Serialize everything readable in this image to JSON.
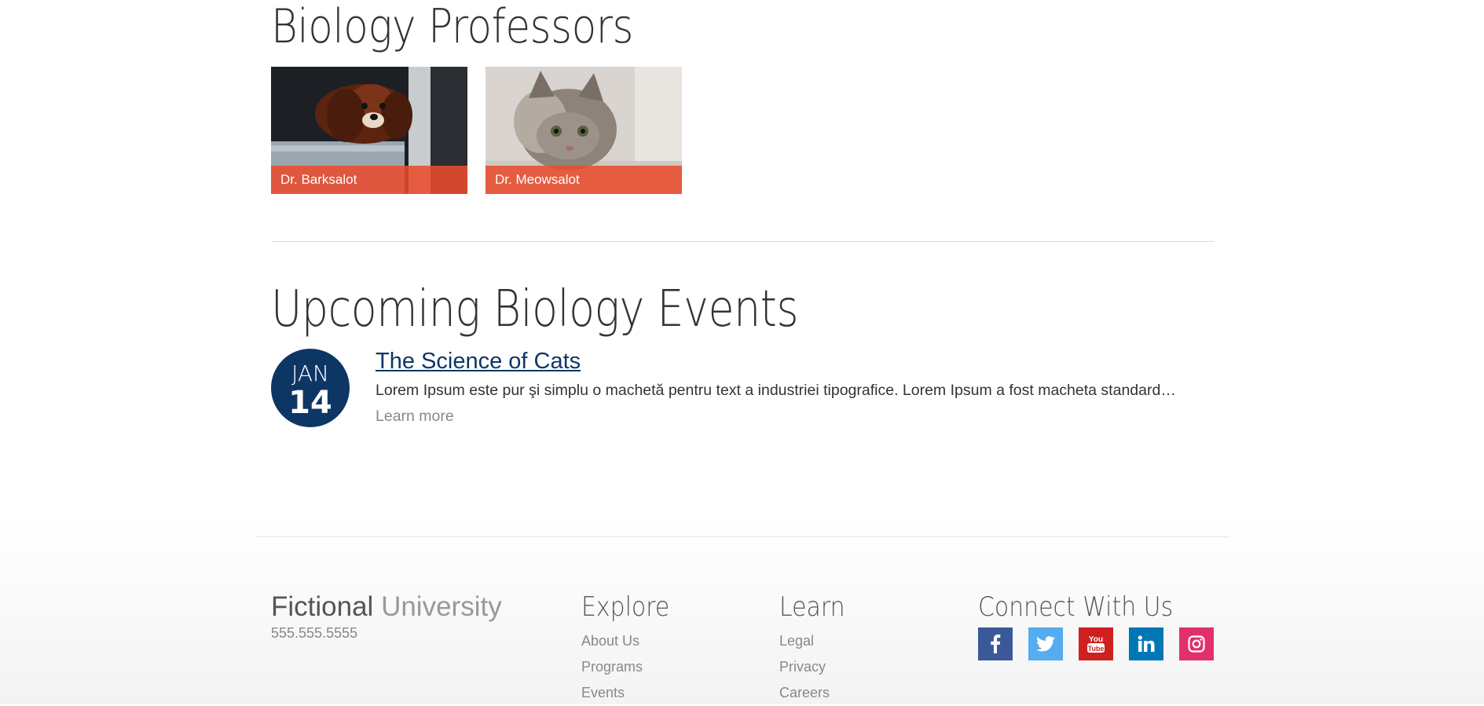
{
  "professors": {
    "heading": "Biology Professors",
    "items": [
      {
        "name": "Dr. Barksalot",
        "photo": "dog-photo"
      },
      {
        "name": "Dr. Meowsalot",
        "photo": "cat-photo"
      }
    ]
  },
  "events": {
    "heading": "Upcoming Biology Events",
    "items": [
      {
        "month": "JAN",
        "day": "14",
        "title": "The Science of Cats",
        "description": "Lorem Ipsum este pur şi simplu o machetă pentru text a industriei tipografice. Lorem Ipsum a fost macheta standard…",
        "learn_more": "Learn more"
      }
    ]
  },
  "footer": {
    "brand_bold": "Fictional",
    "brand_light": "University",
    "phone": "555.555.5555",
    "explore": {
      "title": "Explore",
      "links": [
        "About Us",
        "Programs",
        "Events"
      ]
    },
    "learn": {
      "title": "Learn",
      "links": [
        "Legal",
        "Privacy",
        "Careers"
      ]
    },
    "connect": {
      "title": "Connect With Us",
      "icons": [
        {
          "name": "facebook-icon",
          "color": "#3b5998"
        },
        {
          "name": "twitter-icon",
          "color": "#55acee"
        },
        {
          "name": "youtube-icon",
          "color": "#cd201f"
        },
        {
          "name": "linkedin-icon",
          "color": "#0077b5"
        },
        {
          "name": "instagram-icon",
          "color": "#e1306c"
        }
      ]
    }
  },
  "colors": {
    "accent": "#e84c2d",
    "navy": "#0e3665"
  }
}
